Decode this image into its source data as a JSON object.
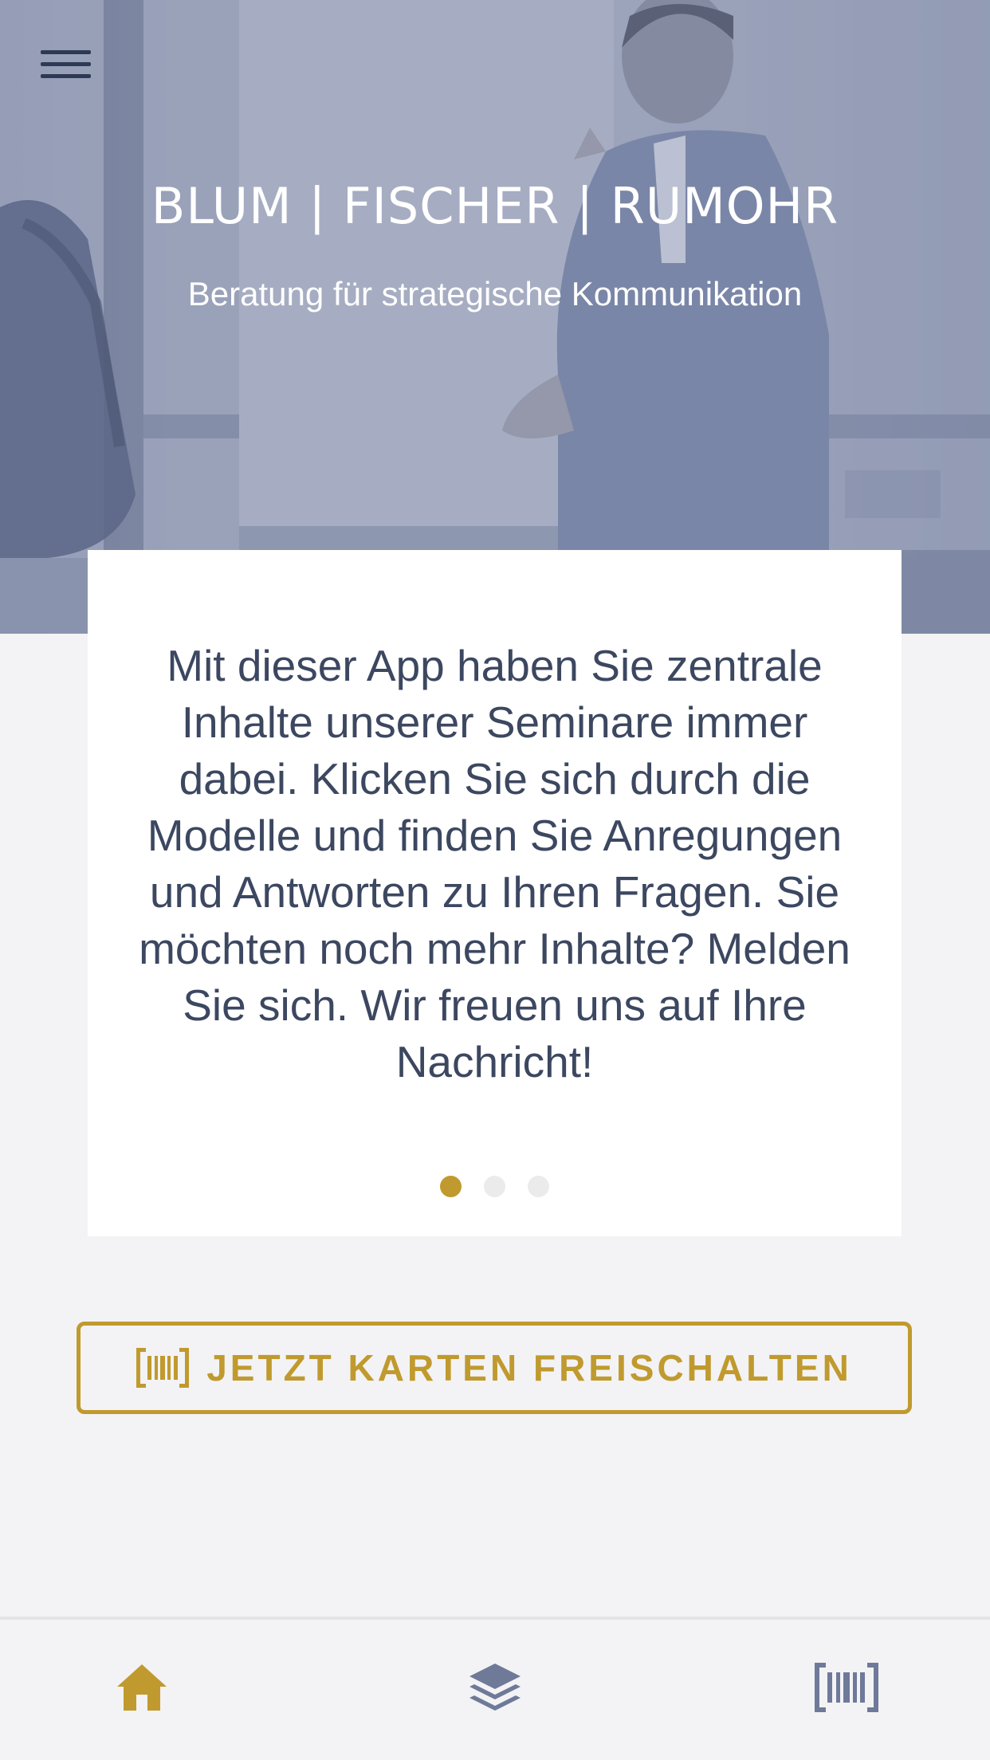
{
  "header": {
    "menu_icon": "hamburger-menu-icon",
    "brand_title": "BLUM | FISCHER | RUMOHR",
    "brand_subtitle": "Beratung für strategische Kommunikation"
  },
  "intro_card": {
    "text": "Mit dieser App haben Sie zentrale Inhalte unserer Seminare immer dabei. Klicken Sie sich durch die Modelle und finden Sie Anregungen und Antworten zu Ihren Fragen. Sie möchten noch mehr Inhalte? Melden Sie sich. Wir freuen uns auf Ihre Nachricht!",
    "page_count": 3,
    "active_page": 1
  },
  "unlock_button": {
    "label": "JETZT KARTEN FREISCHALTEN",
    "icon": "barcode-icon"
  },
  "tabbar": {
    "items": [
      {
        "icon": "home-icon",
        "active": true
      },
      {
        "icon": "layers-icon",
        "active": false
      },
      {
        "icon": "barcode-icon",
        "active": false
      }
    ]
  },
  "colors": {
    "accent": "#c09a2e",
    "text": "#3c4760",
    "inactive_icon": "#6f7a99",
    "background": "#f3f3f5"
  }
}
